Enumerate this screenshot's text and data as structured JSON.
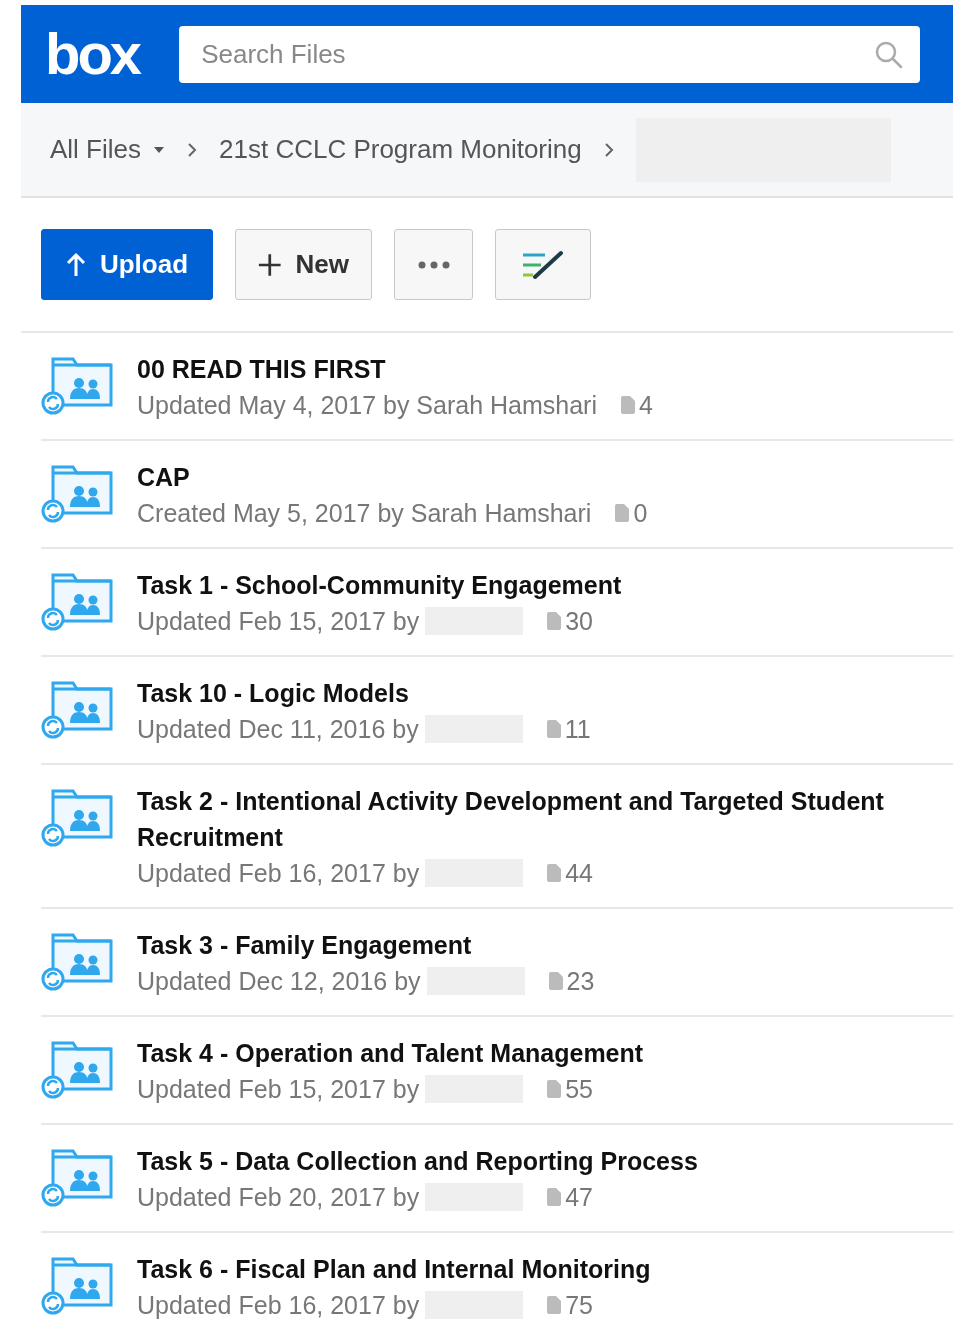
{
  "header": {
    "logo": "box",
    "search": {
      "placeholder": "Search Files"
    }
  },
  "breadcrumb": {
    "items": [
      {
        "label": "All Files",
        "dropdown": true
      },
      {
        "label": "21st CCLC Program Monitoring",
        "dropdown": false
      }
    ],
    "hidden_last": true
  },
  "toolbar": {
    "buttons": [
      {
        "kind": "upload",
        "label": "Upload"
      },
      {
        "kind": "new",
        "label": "New"
      },
      {
        "kind": "more"
      },
      {
        "kind": "notes"
      }
    ]
  },
  "folders": [
    {
      "name": "00 READ THIS FIRST",
      "meta": "Updated May 4, 2017 by Sarah Hamshari",
      "redacted": false,
      "count": "4"
    },
    {
      "name": "CAP",
      "meta": "Created May 5, 2017 by Sarah Hamshari",
      "redacted": false,
      "count": "0"
    },
    {
      "name": "Task 1 - School-Community Engagement",
      "meta": "Updated Feb 15, 2017 by",
      "redacted": true,
      "count": "30"
    },
    {
      "name": "Task 10 - Logic Models",
      "meta": "Updated Dec 11, 2016 by",
      "redacted": true,
      "count": "11"
    },
    {
      "name": "Task 2 - Intentional Activity Development and Targeted Student Recruitment",
      "meta": "Updated Feb 16, 2017 by",
      "redacted": true,
      "count": "44"
    },
    {
      "name": "Task 3 - Family Engagement",
      "meta": "Updated Dec 12, 2016 by",
      "redacted": true,
      "count": "23"
    },
    {
      "name": "Task 4 - Operation and Talent Management",
      "meta": "Updated Feb 15, 2017 by",
      "redacted": true,
      "count": "55"
    },
    {
      "name": "Task 5 - Data Collection and Reporting Process",
      "meta": "Updated Feb 20, 2017 by",
      "redacted": true,
      "count": "47"
    },
    {
      "name": "Task 6 - Fiscal Plan and Internal Monitoring",
      "meta": "Updated Feb 16, 2017 by",
      "redacted": true,
      "count": "75"
    }
  ]
}
